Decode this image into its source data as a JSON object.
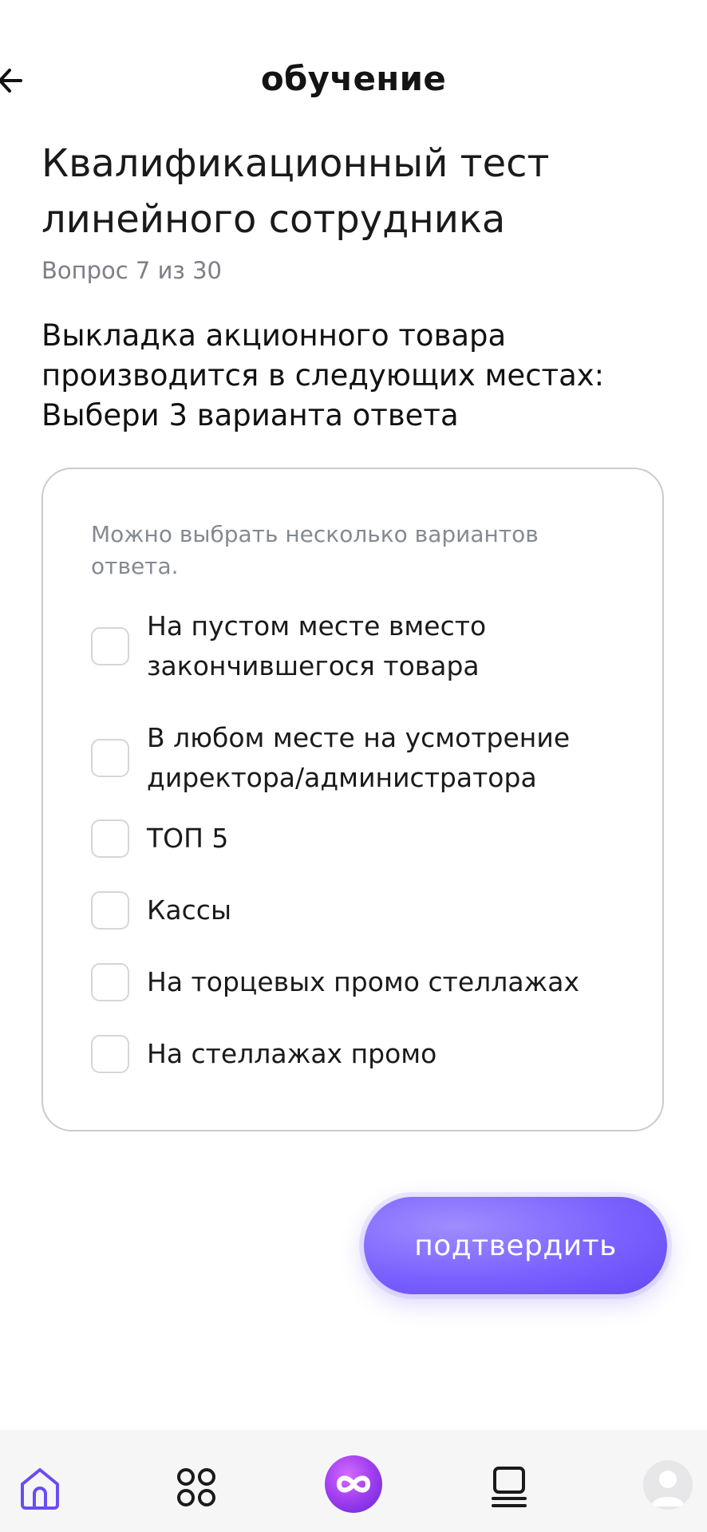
{
  "header": {
    "title": "обучение"
  },
  "test": {
    "title": "Квалификационный тест линейного сотрудника",
    "progress": "Вопрос 7 из 30",
    "question": "Выкладка акционного товара производится в следующих местах: Выбери 3 варианта ответа"
  },
  "card": {
    "hint": "Можно выбрать несколько вариантов ответа.",
    "options": [
      {
        "label": "На пустом месте вместо закончившегося товара",
        "checked": false
      },
      {
        "label": "В любом месте на усмотрение директора/администратора",
        "checked": false
      },
      {
        "label": "ТОП 5",
        "checked": false
      },
      {
        "label": "Кассы",
        "checked": false
      },
      {
        "label": "На торцевых промо стеллажах",
        "checked": false
      },
      {
        "label": "На стеллажах промо",
        "checked": false
      }
    ]
  },
  "actions": {
    "confirm_label": "подтвердить"
  },
  "tabbar": {
    "items": [
      {
        "icon": "home-icon",
        "active": true
      },
      {
        "icon": "apps-grid-icon",
        "active": false
      },
      {
        "icon": "infinity-icon",
        "active": false
      },
      {
        "icon": "courses-icon",
        "active": false
      },
      {
        "icon": "profile-avatar",
        "active": false
      }
    ]
  },
  "colors": {
    "accent": "#7a61ff",
    "border": "#c8cbd0",
    "muted_text": "#7b7f86"
  }
}
